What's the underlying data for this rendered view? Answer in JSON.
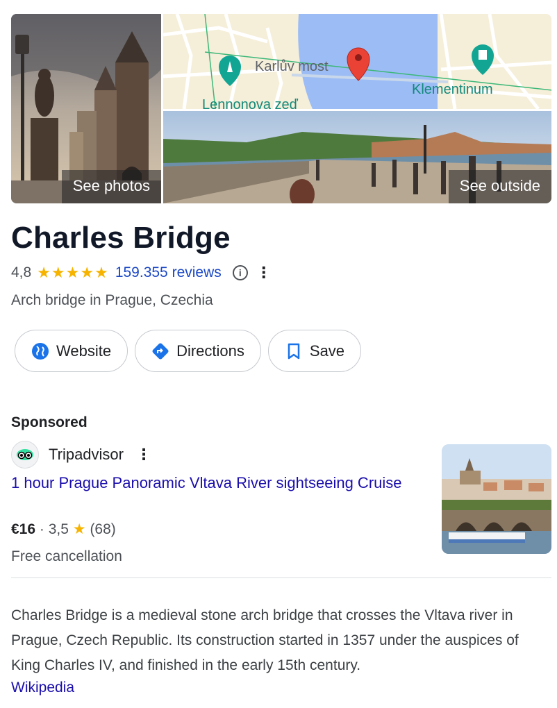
{
  "gallery": {
    "photos_label": "See photos",
    "outside_label": "See outside",
    "map_labels": {
      "bridge": "Karlův most",
      "museum": "Klementinum",
      "wall": "Lennonova zeď"
    }
  },
  "place": {
    "title": "Charles Bridge",
    "rating": "4,8",
    "stars": "★★★★★",
    "reviews": "159.355 reviews",
    "info_icon": "i",
    "more_icon": "⋮",
    "category": "Arch bridge in Prague, Czechia"
  },
  "actions": [
    {
      "label": "Website",
      "icon": "globe-icon"
    },
    {
      "label": "Directions",
      "icon": "directions-icon"
    },
    {
      "label": "Save",
      "icon": "bookmark-icon"
    }
  ],
  "ad": {
    "sponsored_label": "Sponsored",
    "advertiser": "Tripadvisor",
    "more_icon": "⋮",
    "title": "1 hour Prague Panoramic Vltava River sightseeing Cruise",
    "price": "€16",
    "separator": " · ",
    "rating": "3,5",
    "star": "★",
    "count": "(68)",
    "note": "Free cancellation"
  },
  "description": {
    "text": "Charles Bridge is a medieval stone arch bridge that crosses the Vltava river in Prague, Czech Republic. Its construction started in 1357 under the auspices of King Charles IV, and finished in the early 15th century.",
    "source": "Wikipedia"
  },
  "colors": {
    "link": "#1a0dab",
    "reviews_link": "#1a47c4",
    "star": "#f6b400",
    "icon_blue": "#1a73e8",
    "map_water": "#9bbcf5",
    "map_pin": "#ea4335",
    "map_teal": "#12a594"
  }
}
